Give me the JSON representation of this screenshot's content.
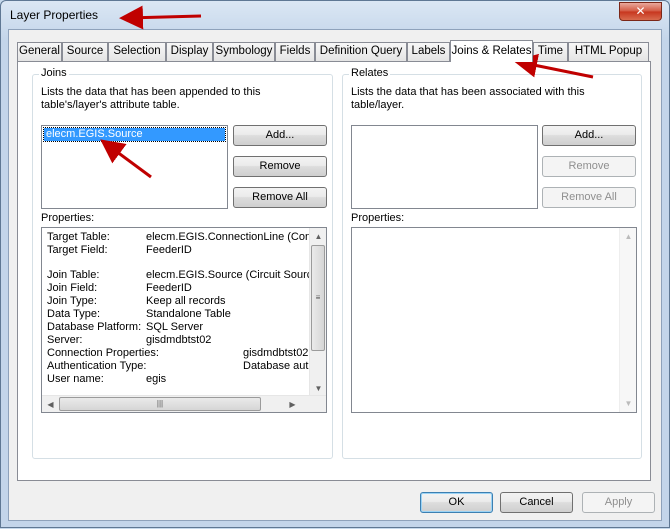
{
  "window": {
    "title": "Layer Properties",
    "close_glyph": "✕"
  },
  "tabs": [
    {
      "label": "General"
    },
    {
      "label": "Source"
    },
    {
      "label": "Selection"
    },
    {
      "label": "Display"
    },
    {
      "label": "Symbology"
    },
    {
      "label": "Fields"
    },
    {
      "label": "Definition Query"
    },
    {
      "label": "Labels"
    },
    {
      "label": "Joins & Relates",
      "active": true
    },
    {
      "label": "Time"
    },
    {
      "label": "HTML Popup"
    }
  ],
  "joins": {
    "title": "Joins",
    "description": "Lists the data that has been appended to this table's/layer's attribute table.",
    "items": [
      "elecm.EGIS.Source"
    ],
    "add_label": "Add...",
    "remove_label": "Remove",
    "remove_all_label": "Remove All",
    "properties_label": "Properties:",
    "properties": [
      {
        "key": "Target Table:",
        "value": "elecm.EGIS.ConnectionLine (Conn"
      },
      {
        "key": "Target Field:",
        "value": "FeederID"
      },
      {
        "key": "",
        "value": ""
      },
      {
        "key": "Join Table:",
        "value": "elecm.EGIS.Source (Circuit Source"
      },
      {
        "key": "Join Field:",
        "value": "FeederID"
      },
      {
        "key": "Join Type:",
        "value": "Keep all records"
      },
      {
        "key": "Data Type:",
        "value": "Standalone Table"
      },
      {
        "key": "Database Platform:",
        "value": "SQL Server"
      },
      {
        "key": "Server:",
        "value": "gisdmdbtst02"
      },
      {
        "key": "Connection Properties:",
        "value": "gisdmdbtst02",
        "wide": true
      },
      {
        "key": "Authentication Type:",
        "value": "Database aut",
        "wide": true
      },
      {
        "key": "User name:",
        "value": "egis"
      }
    ]
  },
  "relates": {
    "title": "Relates",
    "description": "Lists the data that has been associated with this table/layer.",
    "add_label": "Add...",
    "remove_label": "Remove",
    "remove_all_label": "Remove All",
    "properties_label": "Properties:"
  },
  "footer": {
    "ok_label": "OK",
    "cancel_label": "Cancel",
    "apply_label": "Apply"
  },
  "colors": {
    "annotation_arrow": "#c00000",
    "selection": "#3399ff"
  }
}
